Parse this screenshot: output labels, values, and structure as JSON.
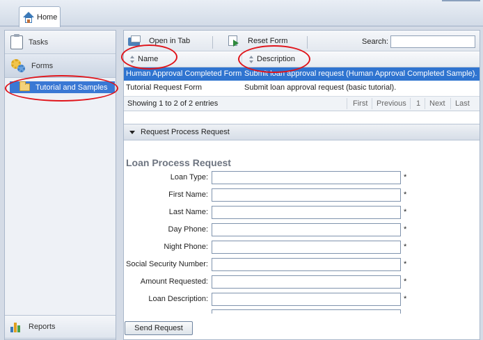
{
  "topbar": {
    "home_tab_label": "Home"
  },
  "sidebar": {
    "tasks_label": "Tasks",
    "forms_label": "Forms",
    "tree_item_label": "Tutorial and Samples",
    "reports_label": "Reports"
  },
  "toolbar": {
    "open_label": "Open in Tab",
    "reset_label": "Reset Form",
    "search_label": "Search:",
    "search_value": ""
  },
  "grid": {
    "columns": [
      "Name",
      "Description"
    ],
    "rows": [
      {
        "name": "Human Approval Completed Form",
        "description": "Submit loan approval request (Human Approval Completed Sample).",
        "selected": true
      },
      {
        "name": "Tutorial Request Form",
        "description": "Submit loan approval request (basic tutorial).",
        "selected": false
      }
    ],
    "info": "Showing 1 to 2 of 2 entries",
    "pager": {
      "first": "First",
      "previous": "Previous",
      "page": "1",
      "next": "Next",
      "last": "Last"
    }
  },
  "section": {
    "title": "Request Process Request"
  },
  "form": {
    "title": "Loan Process Request",
    "required_mark": "*",
    "fields": [
      {
        "label": "Loan Type:",
        "value": ""
      },
      {
        "label": "First Name:",
        "value": ""
      },
      {
        "label": "Last Name:",
        "value": ""
      },
      {
        "label": "Day Phone:",
        "value": ""
      },
      {
        "label": "Night Phone:",
        "value": ""
      },
      {
        "label": "Social Security Number:",
        "value": ""
      },
      {
        "label": "Amount Requested:",
        "value": ""
      },
      {
        "label": "Loan Description:",
        "value": ""
      }
    ],
    "submit_label": "Send Request"
  },
  "colors": {
    "selection": "#2f74d0",
    "annotation": "#e0141a",
    "panel_border": "#a9b7ca"
  }
}
